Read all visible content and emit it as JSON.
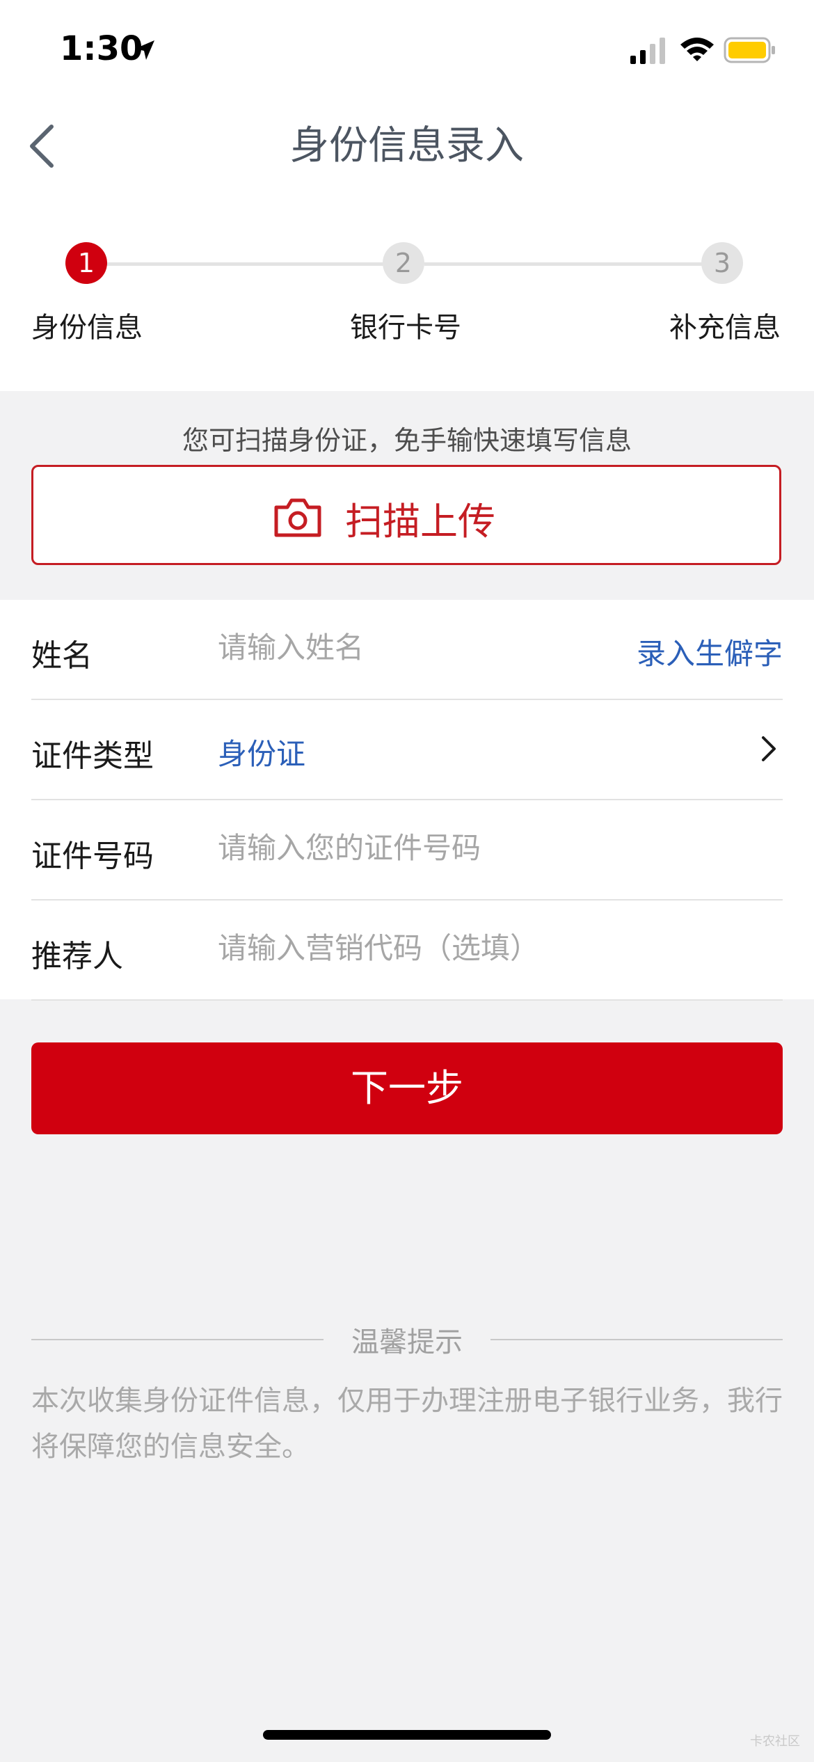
{
  "status_bar": {
    "time": "1:30"
  },
  "nav": {
    "title": "身份信息录入"
  },
  "steps": [
    {
      "number": "1",
      "label": "身份信息",
      "active": true
    },
    {
      "number": "2",
      "label": "银行卡号",
      "active": false
    },
    {
      "number": "3",
      "label": "补充信息",
      "active": false
    }
  ],
  "scan": {
    "hint": "您可扫描身份证，免手输快速填写信息",
    "button_label": "扫描上传"
  },
  "form": {
    "name": {
      "label": "姓名",
      "placeholder": "请输入姓名",
      "link": "录入生僻字"
    },
    "id_type": {
      "label": "证件类型",
      "value": "身份证"
    },
    "id_number": {
      "label": "证件号码",
      "placeholder": "请输入您的证件号码"
    },
    "referrer": {
      "label": "推荐人",
      "placeholder": "请输入营销代码（选填）"
    }
  },
  "next_button": "下一步",
  "tip": {
    "title": "温馨提示",
    "text": "本次收集身份证件信息，仅用于办理注册电子银行业务，我行将保障您的信息安全。"
  },
  "watermark": "卡农社区",
  "colors": {
    "brand_red": "#d0000f",
    "link_blue": "#2b5fb8",
    "battery": "#ffcc00"
  }
}
